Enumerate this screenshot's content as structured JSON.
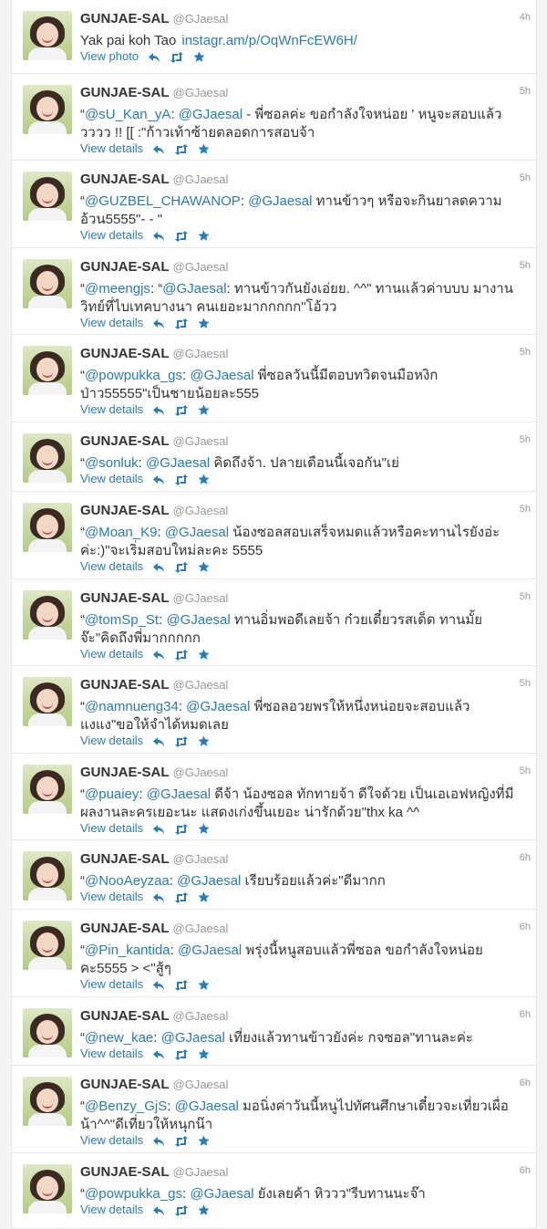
{
  "tweets": [
    {
      "name": "GUNJAE-SAL",
      "handle": "@GJaesal",
      "time": "4h",
      "prefix": "",
      "mention1": "",
      "mention2": "",
      "body": "Yak pai koh Tao",
      "link": "instagr.am/p/OqWnFcEW6H/",
      "action": "View photo",
      "lines": 1
    },
    {
      "name": "GUNJAE-SAL",
      "handle": "@GJaesal",
      "time": "5h",
      "prefix": "“",
      "mention1": "@sU_Kan_yA",
      "mention2": "@GJaesal",
      "body": " - พี่ซอลค่ะ ขอกำลังใจหน่อย ' หนูจะสอบแล้ววววว !! [[ :\"ก้าวเท้าซ้ายตลอดการสอบจ้า",
      "link": "",
      "action": "View details",
      "lines": 2
    },
    {
      "name": "GUNJAE-SAL",
      "handle": "@GJaesal",
      "time": "5h",
      "prefix": "“",
      "mention1": "@GUZBEL_CHAWANOP",
      "mention2": "@GJaesal",
      "body": " ทานข้าวๆ หรือจะกินยาลดความอ้วน5555\"- - \"",
      "link": "",
      "action": "View details",
      "lines": 2
    },
    {
      "name": "GUNJAE-SAL",
      "handle": "@GJaesal",
      "time": "5h",
      "prefix": "“",
      "mention1": "@meengjs",
      "mention2": "@GJaesal",
      "body": ": ทานข้าวกันยังเอ่ยย. ^^\" ทานแล้วค่าบบบ มางานวิทย์ที่ไบเทคบางนา คนเยอะมากกกกก\"โอ้วว",
      "link": "",
      "action": "View details",
      "lines": 2,
      "sep": ": “"
    },
    {
      "name": "GUNJAE-SAL",
      "handle": "@GJaesal",
      "time": "5h",
      "prefix": "“",
      "mention1": "@powpukka_gs",
      "mention2": "@GJaesal",
      "body": " พี่ซอลวันนี้มีตอบทวิตจนมือหงิกป่าว55555\"เป็นชายน้อยละ555",
      "link": "",
      "action": "View details",
      "lines": 2
    },
    {
      "name": "GUNJAE-SAL",
      "handle": "@GJaesal",
      "time": "5h",
      "prefix": "“",
      "mention1": "@sonluk",
      "mention2": "@GJaesal",
      "body": " คิดถึงจ้า. ปลายเดือนนี้เจอกัน\"เย่",
      "link": "",
      "action": "View details",
      "lines": 1
    },
    {
      "name": "GUNJAE-SAL",
      "handle": "@GJaesal",
      "time": "5h",
      "prefix": "“",
      "mention1": "@Moan_K9",
      "mention2": "@GJaesal",
      "body": " น้องซอลสอบเสร็จหมดแล้วหรือคะทานไรยังอ่ะค่ะ:)\"จะเริ่มสอบใหม่ละคะ 5555",
      "link": "",
      "action": "View details",
      "lines": 2
    },
    {
      "name": "GUNJAE-SAL",
      "handle": "@GJaesal",
      "time": "5h",
      "prefix": "“",
      "mention1": "@tomSp_St",
      "mention2": "@GJaesal",
      "body": " ทานอิ่มพอดีเลยจ้า ก๋วยเตี๋ยวรสเด็ด ทานมั้ยจ๊ะ\"คิดถึงพี่มากกกกก",
      "link": "",
      "action": "View details",
      "lines": 2
    },
    {
      "name": "GUNJAE-SAL",
      "handle": "@GJaesal",
      "time": "5h",
      "prefix": "“",
      "mention1": "@namnueng34",
      "mention2": "@GJaesal",
      "body": " พี่ซอลอวยพรให้หนึ่งหน่อยจะสอบแล้ว แงแง\"ขอให้จำได้หมดเลย",
      "link": "",
      "action": "View details",
      "lines": 2
    },
    {
      "name": "GUNJAE-SAL",
      "handle": "@GJaesal",
      "time": "5h",
      "prefix": "“",
      "mention1": "@puaiey",
      "mention2": "@GJaesal",
      "body": " ดีจ้า น้องซอล ทักทายจ้า ดีใจด้วย เป็นเอเอฟหญิงที่มีผลงานละครเยอะนะ แสดงเก่งขึ้นเยอะ น่ารักด้วย\"thx ka ^^",
      "link": "",
      "action": "View details",
      "lines": 2
    },
    {
      "name": "GUNJAE-SAL",
      "handle": "@GJaesal",
      "time": "6h",
      "prefix": "“",
      "mention1": "@NooAeyzaa",
      "mention2": "@GJaesal",
      "body": " เรียบร้อยแล้วค่ะ\"ดีมากก",
      "link": "",
      "action": "View details",
      "lines": 1
    },
    {
      "name": "GUNJAE-SAL",
      "handle": "@GJaesal",
      "time": "6h",
      "prefix": "“",
      "mention1": "@Pin_kantida",
      "mention2": "@GJaesal",
      "body": " พรุ่งนี้หนูสอบแล้วพี่ซอล ขอกำลังใจหน่อยคะ5555 > <\"สู้ๆ",
      "link": "",
      "action": "View details",
      "lines": 2
    },
    {
      "name": "GUNJAE-SAL",
      "handle": "@GJaesal",
      "time": "6h",
      "prefix": "“",
      "mention1": "@new_kae",
      "mention2": "@GJaesal",
      "body": " เที่ยงแล้วทานข้าวยังค่ะ กจซอล\"ทานละค่ะ",
      "link": "",
      "action": "View details",
      "lines": 1
    },
    {
      "name": "GUNJAE-SAL",
      "handle": "@GJaesal",
      "time": "6h",
      "prefix": "“",
      "mention1": "@Benzy_GjS",
      "mention2": "@GJaesal",
      "body": " มอนิ่งค่าวันนี้หนูไปทัศนศึกษาเดี๋ยวจะเที่ยวเผื่อน้า^^\"ดีเที่ยวให้หนุกน๊า",
      "link": "",
      "action": "View details",
      "lines": 2
    },
    {
      "name": "GUNJAE-SAL",
      "handle": "@GJaesal",
      "time": "6h",
      "prefix": "“",
      "mention1": "@powpukka_gs",
      "mention2": "@GJaesal",
      "body": " ยังเลยค้า หิววว\"รีบทานนะจ๊า",
      "link": "",
      "action": "View details",
      "lines": 1
    }
  ],
  "colors": {
    "link": "#2b7bb9",
    "name": "#333333",
    "muted": "#999999"
  },
  "icons": [
    "reply-icon",
    "retweet-icon",
    "favorite-icon"
  ]
}
